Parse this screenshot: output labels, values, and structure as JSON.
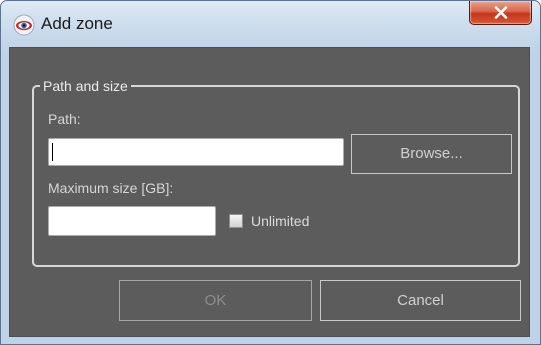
{
  "window": {
    "title": "Add zone",
    "close_symbol": "x",
    "icon": "eye-icon"
  },
  "group": {
    "legend": "Path and size",
    "path_label": "Path:",
    "path_value": "",
    "browse_label": "Browse...",
    "size_label": "Maximum size [GB]:",
    "size_value": "",
    "unlimited_label": "Unlimited",
    "unlimited_checked": false
  },
  "buttons": {
    "ok_label": "OK",
    "cancel_label": "Cancel"
  },
  "colors": {
    "client_background": "#5c5c5c",
    "close_button": "#c5361a"
  }
}
